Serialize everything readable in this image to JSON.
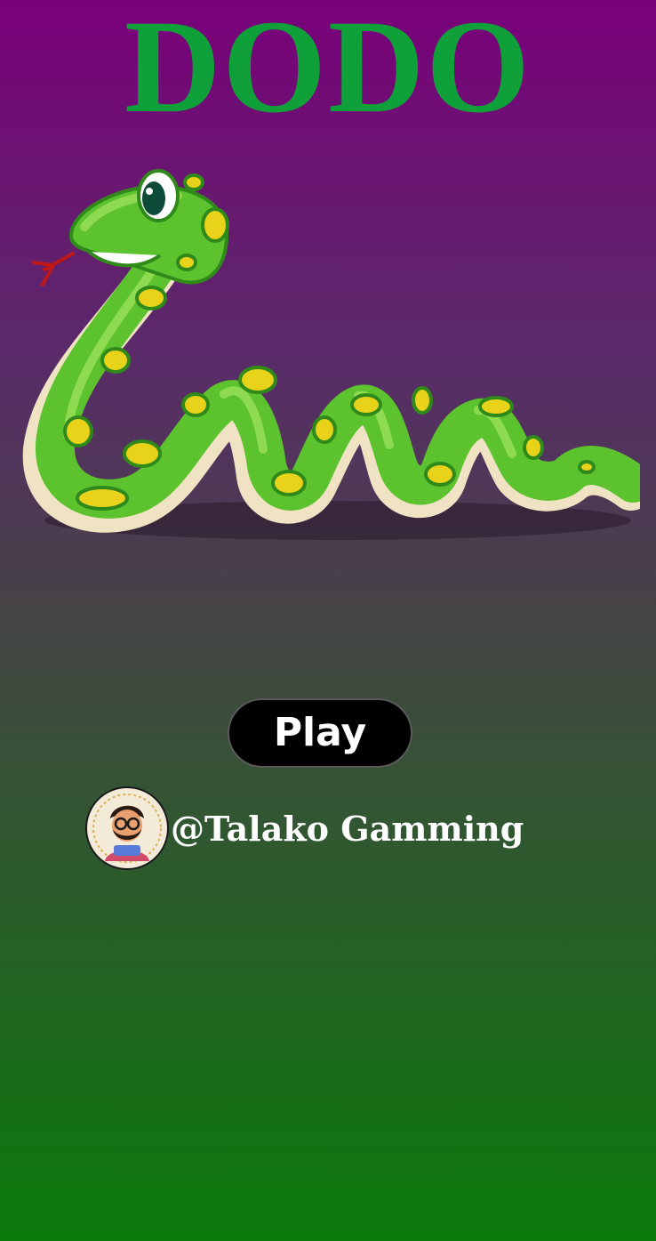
{
  "game": {
    "title": "DODO",
    "play_label": "Play",
    "credit_handle": "@Talako Gamming"
  },
  "colors": {
    "title": "#10a03a",
    "gradient_top": "#7a007a",
    "gradient_bottom": "#0a7a0a",
    "snake_body": "#5cc22e",
    "snake_spots": "#e8d21a",
    "snake_belly": "#efe3c3",
    "button_bg": "#000000",
    "button_text": "#ffffff"
  },
  "icons": {
    "mascot": "snake-icon",
    "avatar": "avatar-icon"
  }
}
